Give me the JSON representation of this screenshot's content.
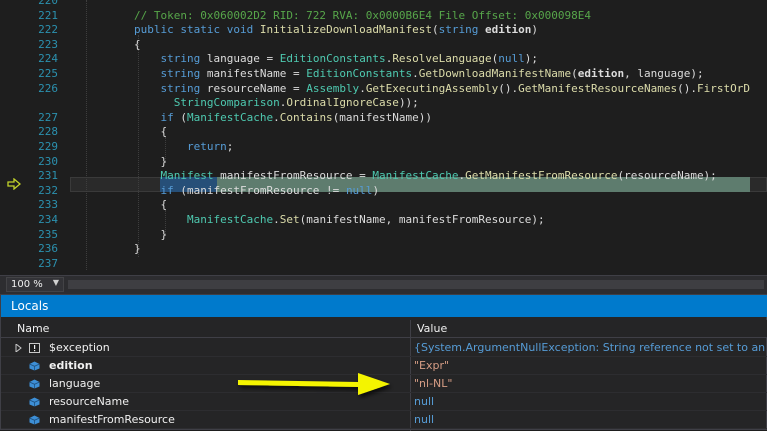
{
  "editor": {
    "lines": [
      {
        "num": "220",
        "parts": []
      },
      {
        "num": "221",
        "parts": [
          {
            "t": "// Token: 0x060002D2 RID: 722 RVA: 0x0000B6E4 File Offset: 0x000098E4",
            "c": "cm"
          }
        ]
      },
      {
        "num": "222",
        "parts": [
          {
            "t": "public static void ",
            "c": "kw"
          },
          {
            "t": "InitializeDownloadManifest",
            "c": "fn"
          },
          {
            "t": "(",
            "c": ""
          },
          {
            "t": "string ",
            "c": "kw"
          },
          {
            "t": "edition",
            "c": "bold"
          },
          {
            "t": ")",
            "c": ""
          }
        ]
      },
      {
        "num": "223",
        "parts": [
          {
            "t": "{",
            "c": ""
          }
        ]
      },
      {
        "num": "224",
        "parts": [
          {
            "t": "    string ",
            "c": "kw"
          },
          {
            "t": "language = ",
            "c": ""
          },
          {
            "t": "EditionConstants",
            "c": "ty"
          },
          {
            "t": ".",
            "c": ""
          },
          {
            "t": "ResolveLanguage",
            "c": "fn"
          },
          {
            "t": "(",
            "c": ""
          },
          {
            "t": "null",
            "c": "kw"
          },
          {
            "t": ");",
            "c": ""
          }
        ]
      },
      {
        "num": "225",
        "parts": [
          {
            "t": "    string ",
            "c": "kw"
          },
          {
            "t": "manifestName = ",
            "c": ""
          },
          {
            "t": "EditionConstants",
            "c": "ty"
          },
          {
            "t": ".",
            "c": ""
          },
          {
            "t": "GetDownloadManifestName",
            "c": "fn"
          },
          {
            "t": "(",
            "c": ""
          },
          {
            "t": "edition",
            "c": "bold"
          },
          {
            "t": ", language);",
            "c": ""
          }
        ]
      },
      {
        "num": "226",
        "parts": [
          {
            "t": "    string ",
            "c": "kw"
          },
          {
            "t": "resourceName = ",
            "c": ""
          },
          {
            "t": "Assembly",
            "c": "ty"
          },
          {
            "t": ".",
            "c": ""
          },
          {
            "t": "GetExecutingAssembly",
            "c": "fn"
          },
          {
            "t": "().",
            "c": ""
          },
          {
            "t": "GetManifestResourceNames",
            "c": "fn"
          },
          {
            "t": "().",
            "c": ""
          },
          {
            "t": "FirstOrD",
            "c": "fn"
          }
        ]
      },
      {
        "num": "",
        "parts": [
          {
            "t": "      ",
            "c": ""
          },
          {
            "t": "StringComparison",
            "c": "ty"
          },
          {
            "t": ".",
            "c": ""
          },
          {
            "t": "OrdinalIgnoreCase",
            "c": "fn"
          },
          {
            "t": "));",
            "c": ""
          }
        ]
      },
      {
        "num": "227",
        "parts": [
          {
            "t": "    if ",
            "c": "kw"
          },
          {
            "t": "(",
            "c": ""
          },
          {
            "t": "ManifestCache",
            "c": "ty"
          },
          {
            "t": ".",
            "c": ""
          },
          {
            "t": "Contains",
            "c": "fn"
          },
          {
            "t": "(manifestName))",
            "c": ""
          }
        ]
      },
      {
        "num": "228",
        "parts": [
          {
            "t": "    {",
            "c": ""
          }
        ]
      },
      {
        "num": "229",
        "parts": [
          {
            "t": "        return",
            "c": "kw"
          },
          {
            "t": ";",
            "c": ""
          }
        ]
      },
      {
        "num": "230",
        "parts": [
          {
            "t": "    }",
            "c": ""
          }
        ]
      },
      {
        "num": "231",
        "parts": [
          {
            "t": "    Manifest ",
            "c": "ty"
          },
          {
            "t": "manifestFromResource = ",
            "c": ""
          },
          {
            "t": "ManifestCache",
            "c": "ty"
          },
          {
            "t": ".",
            "c": ""
          },
          {
            "t": "GetManifestFromResource",
            "c": "fn"
          },
          {
            "t": "(resourceName);",
            "c": ""
          }
        ]
      },
      {
        "num": "232",
        "parts": [
          {
            "t": "    if ",
            "c": "kw"
          },
          {
            "t": "(manifestFromResource != ",
            "c": ""
          },
          {
            "t": "null",
            "c": "kw"
          },
          {
            "t": ")",
            "c": ""
          }
        ]
      },
      {
        "num": "233",
        "parts": [
          {
            "t": "    {",
            "c": ""
          }
        ]
      },
      {
        "num": "234",
        "parts": [
          {
            "t": "        ManifestCache",
            "c": "ty"
          },
          {
            "t": ".",
            "c": ""
          },
          {
            "t": "Set",
            "c": "fn"
          },
          {
            "t": "(manifestName, manifestFromResource);",
            "c": ""
          }
        ]
      },
      {
        "num": "235",
        "parts": [
          {
            "t": "    }",
            "c": ""
          }
        ]
      },
      {
        "num": "236",
        "parts": [
          {
            "t": "}",
            "c": ""
          }
        ]
      },
      {
        "num": "237",
        "parts": []
      }
    ]
  },
  "zoom": {
    "value": "100 %"
  },
  "locals": {
    "title": "Locals",
    "col_name": "Name",
    "col_value": "Value",
    "rows": [
      {
        "name": "$exception",
        "value": "{System.ArgumentNullException: String reference not set to an insta",
        "icon": "exception-icon",
        "expandable": true,
        "bold": false,
        "value_color": "#569cd6"
      },
      {
        "name": "edition",
        "value": "\"Expr\"",
        "icon": "variable-icon",
        "expandable": false,
        "bold": true,
        "value_color": "#d69d85"
      },
      {
        "name": "language",
        "value": "\"nl-NL\"",
        "icon": "variable-icon",
        "expandable": false,
        "bold": false,
        "value_color": "#d69d85"
      },
      {
        "name": "resourceName",
        "value": "null",
        "icon": "variable-icon",
        "expandable": false,
        "bold": false,
        "value_color": "#569cd6"
      },
      {
        "name": "manifestFromResource",
        "value": "null",
        "icon": "variable-icon",
        "expandable": false,
        "bold": false,
        "value_color": "#569cd6"
      }
    ]
  },
  "colors": {
    "accent": "#007acc",
    "annotation_arrow": "#f4f400",
    "current_statement": "#5e7c6e",
    "selection": "#264f78"
  }
}
